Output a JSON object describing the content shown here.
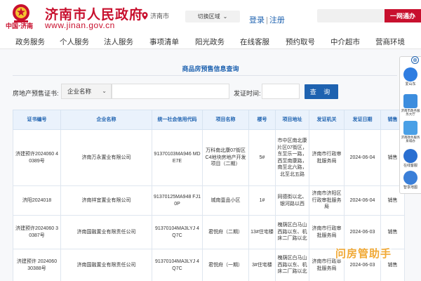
{
  "header": {
    "logo_small": "中国·济南",
    "site_name": "济南市人民政府",
    "site_url": "www.jinan.gov.cn",
    "location": "济南市",
    "switch_region": "切换区域",
    "login": "登录",
    "separator": "|",
    "register": "注册",
    "search_placeholder": "",
    "search_button": "一网通办",
    "brand_color": "#c8102e"
  },
  "nav": {
    "items": [
      "政务服务",
      "个人服务",
      "法人服务",
      "事项清单",
      "阳光政务",
      "在线客服",
      "预约取号",
      "中介超市",
      "营商环境"
    ]
  },
  "main": {
    "title": "商品房预售信息查询",
    "filter": {
      "label": "房地产预售证书:",
      "select_value": "企业名称",
      "input_value": "",
      "date_label": "发证时间:",
      "date_value": "",
      "query_button": "查 询"
    }
  },
  "table": {
    "headers": [
      "证书编号",
      "企业名称",
      "统一社会信用代码",
      "项目名称",
      "楼号",
      "项目地址",
      "发证机关",
      "发证日期",
      "销售"
    ],
    "rows": [
      [
        "济建预许2024060 40389号",
        "济南万永置业有限公司",
        "91370103MA946 MDE7E",
        "万科南北康07街区C4地块房地产开发项目（二期）",
        "5#",
        "市中区南北康片区07街区，东至乐一路，西至南康路，南至北六路，北至北五路",
        "济南市行政审批服务局",
        "2024-06-04",
        "销售"
      ],
      [
        "济阳2024018",
        "济南祥宜置业有限公司",
        "91370125MA948 FJ10P",
        "城南壹品小区",
        "1#",
        "同德街以北、银河路以西",
        "济南市济阳区行政审批服务局",
        "2024-06-04",
        "销售"
      ],
      [
        "济建预许2024060 30387号",
        "济南国融置业有限责任公司",
        "91370104MA3LYJ 4Q7C",
        "君悦府（二期）",
        "13#住宅楼",
        "槐荫区白马山西路以东、机床二厂路以北",
        "济南市行政审批服务局",
        "2024-06-03",
        "销售"
      ],
      [
        "济建预许 2024060 30388号",
        "济南国融置业有限责任公司",
        "91370104MA3LYJ 4Q7C",
        "君悦府（一期）",
        "3#住宅楼",
        "槐荫区白马山西路以东、机床二厂路以北",
        "济南市行政审批服务局",
        "2024-06-03",
        "销售"
      ]
    ]
  },
  "float_bar": {
    "close": "⊗",
    "items": [
      {
        "label": "爱山东",
        "icon": "aishandong-icon",
        "color": "#2f7de1"
      },
      {
        "label": "济南市政务服务大厅",
        "icon": "service-hall-icon",
        "color": "#3c8dde"
      },
      {
        "label": "济南政务服务泉城办",
        "icon": "quancheng-icon",
        "color": "#4aa0e6"
      },
      {
        "label": "在线客服",
        "icon": "customer-service-icon",
        "color": "#2a6fd1"
      },
      {
        "label": "智享地图",
        "icon": "map-icon",
        "color": "#3a7fd8"
      }
    ]
  },
  "watermark": "问房管助手"
}
